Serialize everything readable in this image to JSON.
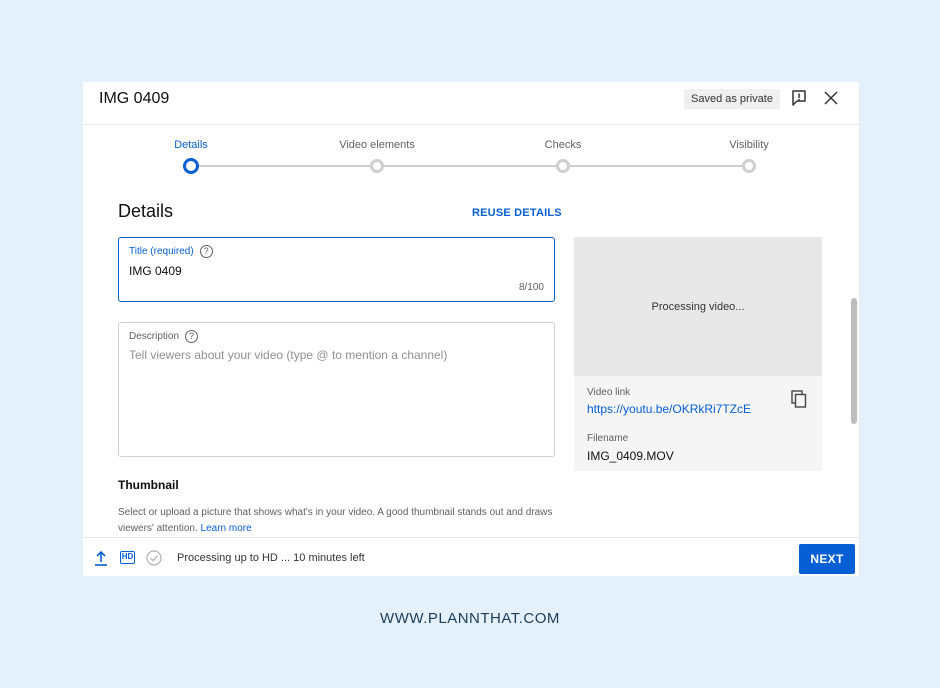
{
  "header": {
    "title": "IMG 0409",
    "saved_badge": "Saved as private",
    "feedback_icon": "report-feedback-icon",
    "close_icon": "close-icon"
  },
  "steps": [
    {
      "label": "Details",
      "state": "active"
    },
    {
      "label": "Video elements",
      "state": "pending"
    },
    {
      "label": "Checks",
      "state": "pending"
    },
    {
      "label": "Visibility",
      "state": "pending"
    }
  ],
  "details": {
    "section_title": "Details",
    "reuse_label": "REUSE DETAILS",
    "title_field": {
      "label": "Title (required)",
      "value": "IMG 0409",
      "count": "8/100"
    },
    "description_field": {
      "label": "Description",
      "placeholder": "Tell viewers about your video (type @ to mention a channel)"
    },
    "help_glyph": "?",
    "thumbnail": {
      "title": "Thumbnail",
      "description": "Select or upload a picture that shows what's in your video. A good thumbnail stands out and draws viewers' attention.",
      "learn_more": "Learn more"
    }
  },
  "preview": {
    "processing": "Processing video...",
    "video_link_label": "Video link",
    "video_link": "https://youtu.be/OKRkRi7TZcE",
    "filename_label": "Filename",
    "filename": "IMG_0409.MOV"
  },
  "footer": {
    "hd_label": "HD",
    "status": "Processing up to HD ... 10 minutes left",
    "next_label": "NEXT"
  },
  "watermark": "WWW.PLANNTHAT.COM",
  "colors": {
    "accent": "#065fd4",
    "background": "#e4f0fb"
  }
}
